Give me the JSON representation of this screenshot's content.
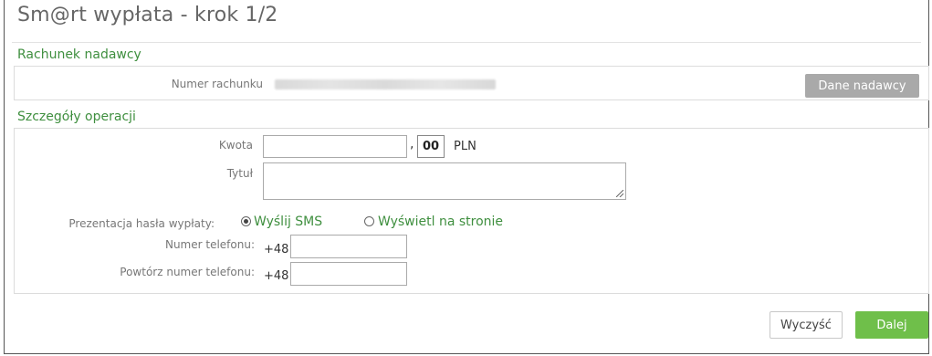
{
  "page": {
    "title": "Sm@rt wypłata - krok 1/2"
  },
  "sender_section": {
    "label": "Rachunek nadawcy",
    "account_label": "Numer rachunku",
    "sender_button": "Dane nadawcy"
  },
  "details_section": {
    "label": "Szczegóły operacji",
    "amount_label": "Kwota",
    "amount_value": "",
    "cents_value": "00",
    "currency": "PLN",
    "title_label": "Tytuł",
    "title_value": "",
    "presentation_label": "Prezentacja hasła wypłaty:",
    "option_sms": "Wyślij SMS",
    "option_sms_selected": true,
    "option_page": "Wyświetl na stronie",
    "option_page_selected": false,
    "phone_label": "Numer telefonu:",
    "phone_prefix": "+48",
    "phone_value": "",
    "phone_repeat_label": "Powtórz numer telefonu:",
    "phone_repeat_prefix": "+48",
    "phone_repeat_value": ""
  },
  "actions": {
    "clear_label": "Wyczyść",
    "next_label": "Dalej"
  },
  "colors": {
    "accent_green": "#3f8f3f",
    "next_button": "#6fbf4a",
    "sender_button": "#a9a9a9"
  }
}
